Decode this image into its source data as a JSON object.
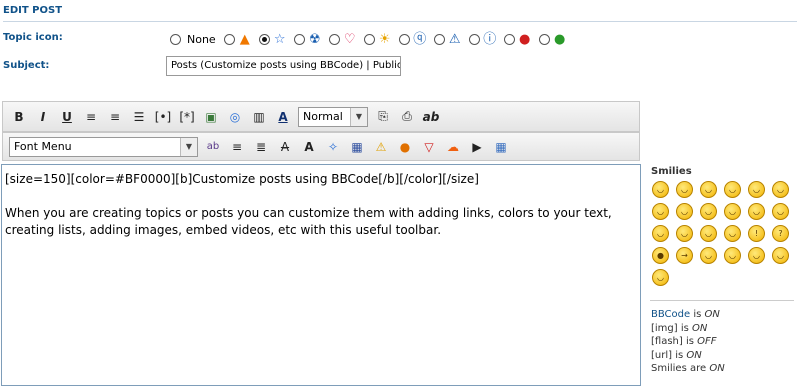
{
  "header": {
    "title": "EDIT POST"
  },
  "topic_icon": {
    "label": "Topic icon:",
    "none_label": "None",
    "selected_index": 2,
    "options": [
      "none",
      "fire-icon",
      "star-icon",
      "radioactive-icon",
      "heart-icon",
      "lightbulb-icon",
      "question-icon",
      "warning-icon",
      "info-icon",
      "mad-icon",
      "grin-icon"
    ]
  },
  "subject": {
    "label": "Subject:",
    "value": "Posts (Customize posts using BBCode) | Publica"
  },
  "toolbar1": {
    "buttons": [
      "B",
      "I",
      "U",
      "≡",
      "≡",
      "☰",
      "[•]",
      "[*]",
      "▣",
      "◎",
      "▥",
      "A"
    ],
    "size_value": "Normal",
    "extra": [
      "⎘",
      "⎙",
      "ab"
    ]
  },
  "toolbar2": {
    "font_menu_value": "Font Menu",
    "buttons": [
      "ab",
      "≡",
      "≣",
      "A",
      "A",
      "✧",
      "▦",
      "⚠",
      "●",
      "▽",
      "☁",
      "▶",
      "▦"
    ]
  },
  "message": {
    "line1": "[size=150][color=#BF0000][b]Customize posts using BBCode[/b][/color][/size]",
    "line2": "When you are creating topics or posts you can customize them with adding links, colors to your text,",
    "line3": "creating lists, adding images, embed videos, etc with this useful toolbar."
  },
  "smilies": {
    "title": "Smilies",
    "faces": [
      "◡",
      "◡",
      "◡",
      "◡",
      "◡",
      "◡",
      "◡",
      "◡",
      "◡",
      "◡",
      "◡",
      "◡",
      "◡",
      "◡",
      "◡",
      "◡",
      "!",
      "?",
      "●",
      "→",
      "◡",
      "◡",
      "◡",
      "◡",
      "◡"
    ]
  },
  "status": {
    "bbcode_link": "BBCode",
    "bbcode_is": " is ",
    "bbcode_state": "ON",
    "img_label": "[img] is ",
    "img_state": "ON",
    "flash_label": "[flash] is ",
    "flash_state": "OFF",
    "url_label": "[url] is ",
    "url_state": "ON",
    "smilies_label": "Smilies are ",
    "smilies_state": "ON"
  },
  "colors": {
    "accent": "#105289",
    "border": "#7e9db9",
    "smiley": "#f2b300"
  }
}
